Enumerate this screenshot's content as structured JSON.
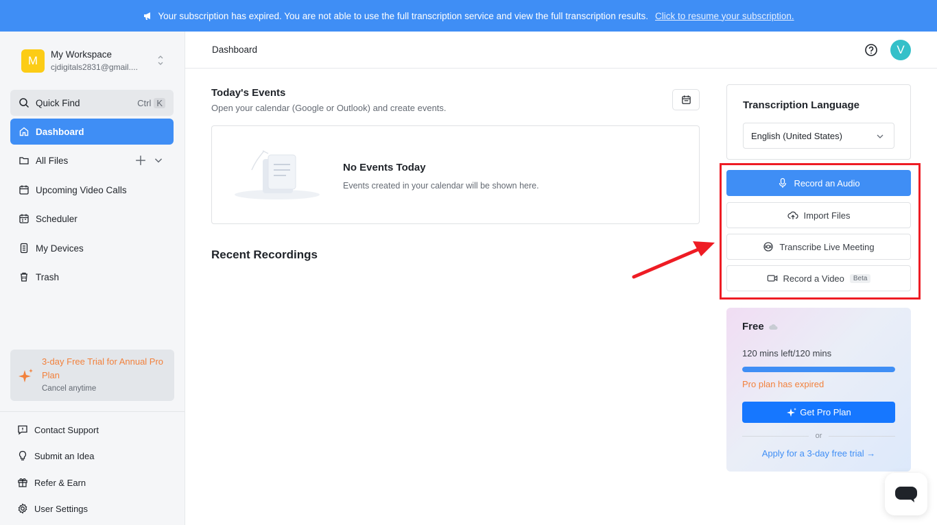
{
  "banner": {
    "message": "Your subscription has expired. You are not able to use the full transcription service and view the full transcription results.",
    "link": "Click to resume your subscription."
  },
  "workspace": {
    "avatar_letter": "M",
    "name": "My Workspace",
    "email": "cjdigitals2831@gmail...."
  },
  "sidebar": {
    "quick_find": {
      "label": "Quick Find",
      "key1": "Ctrl",
      "key2": "K"
    },
    "items": [
      {
        "label": "Dashboard",
        "icon": "home-icon"
      },
      {
        "label": "All Files",
        "icon": "folder-icon"
      },
      {
        "label": "Upcoming Video Calls",
        "icon": "calendar-icon"
      },
      {
        "label": "Scheduler",
        "icon": "scheduler-icon"
      },
      {
        "label": "My Devices",
        "icon": "device-icon"
      },
      {
        "label": "Trash",
        "icon": "trash-icon"
      }
    ],
    "trial": {
      "title": "3-day Free Trial for Annual Pro Plan",
      "subtitle": "Cancel anytime"
    },
    "bottom": [
      {
        "label": "Contact Support",
        "icon": "support-icon"
      },
      {
        "label": "Submit an Idea",
        "icon": "lightbulb-icon"
      },
      {
        "label": "Refer & Earn",
        "icon": "gift-icon"
      },
      {
        "label": "User Settings",
        "icon": "settings-icon"
      }
    ]
  },
  "header": {
    "title": "Dashboard",
    "avatar_letter": "V"
  },
  "events": {
    "title": "Today's Events",
    "subtitle": "Open your calendar (Google or Outlook) and create events.",
    "empty_title": "No Events Today",
    "empty_subtitle": "Events created in your calendar will be shown here."
  },
  "recent": {
    "title": "Recent Recordings"
  },
  "language": {
    "title": "Transcription Language",
    "selected": "English (United States)"
  },
  "actions": {
    "record_audio": "Record an Audio",
    "import_files": "Import Files",
    "transcribe_live": "Transcribe Live Meeting",
    "record_video": "Record a Video",
    "beta": "Beta"
  },
  "plan": {
    "name": "Free",
    "mins": "120 mins left/120 mins",
    "progress": 1.0,
    "expired": "Pro plan has expired",
    "button": "Get Pro Plan",
    "or": "or",
    "trial_link": "Apply for a 3-day free trial"
  },
  "colors": {
    "accent": "#3f8ef5",
    "annotation": "#ee1c24",
    "warning": "#f2813c"
  }
}
